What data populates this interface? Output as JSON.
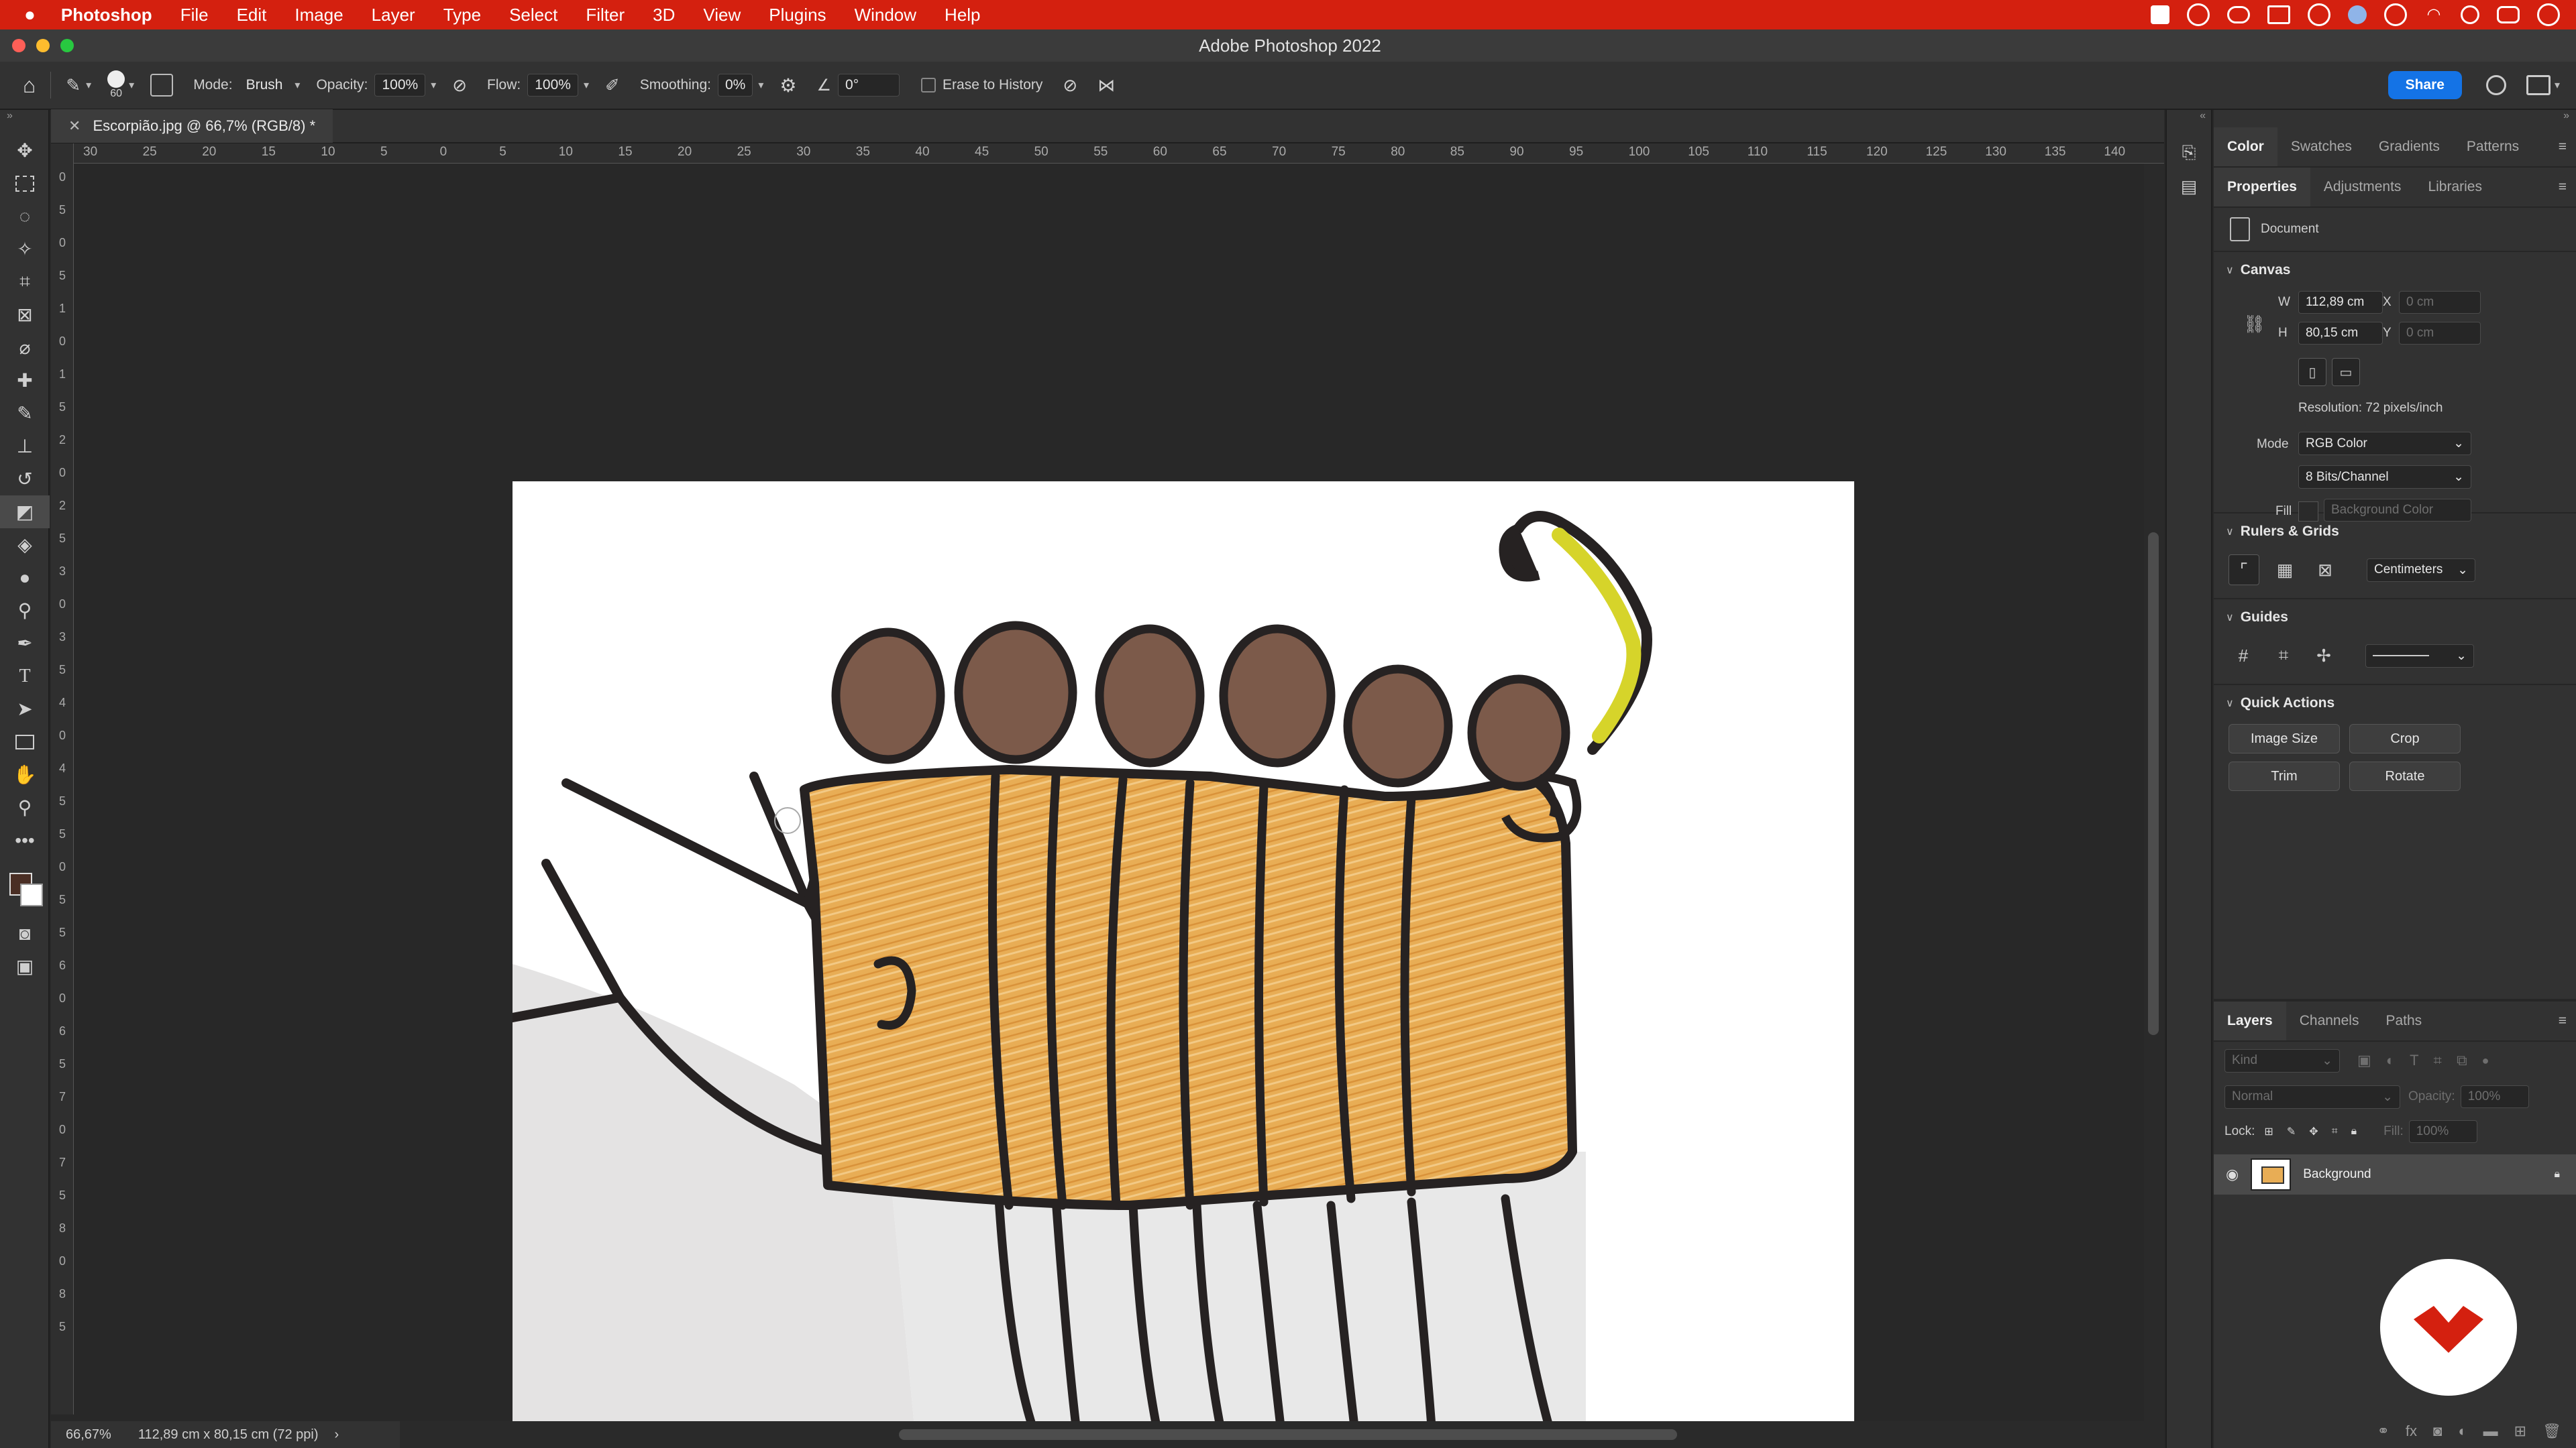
{
  "menubar": {
    "app": "Photoshop",
    "items": [
      "File",
      "Edit",
      "Image",
      "Layer",
      "Type",
      "Select",
      "Filter",
      "3D",
      "View",
      "Plugins",
      "Window",
      "Help"
    ]
  },
  "window": {
    "title": "Adobe Photoshop 2022"
  },
  "options": {
    "brush_size": "60",
    "mode_label": "Mode:",
    "mode_value": "Brush",
    "opacity_label": "Opacity:",
    "opacity_value": "100%",
    "flow_label": "Flow:",
    "flow_value": "100%",
    "smoothing_label": "Smoothing:",
    "smoothing_value": "0%",
    "angle_value": "0°",
    "erase_history_label": "Erase to History",
    "share_label": "Share"
  },
  "document": {
    "tab_title": "Escorpião.jpg @ 66,7% (RGB/8) *",
    "zoom": "66,67%",
    "size_info": "112,89 cm x 80,15 cm (72 ppi)"
  },
  "rulers": {
    "h_ticks": [
      "30",
      "25",
      "20",
      "15",
      "10",
      "5",
      "0",
      "5",
      "10",
      "15",
      "20",
      "25",
      "30",
      "35",
      "40",
      "45",
      "50",
      "55",
      "60",
      "65",
      "70",
      "75",
      "80",
      "85",
      "90",
      "95",
      "100",
      "105",
      "110",
      "115",
      "120",
      "125",
      "130",
      "135",
      "140"
    ],
    "v_ticks": [
      "0",
      "5",
      "0",
      "5",
      "1",
      "0",
      "1",
      "5",
      "2",
      "0",
      "2",
      "5",
      "3",
      "0",
      "3",
      "5",
      "4",
      "0",
      "4",
      "5",
      "5",
      "0",
      "5",
      "5",
      "6",
      "0",
      "6",
      "5",
      "7",
      "0",
      "7",
      "5",
      "8",
      "0",
      "8",
      "5"
    ]
  },
  "panels": {
    "top_tabs": [
      "Color",
      "Swatches",
      "Gradients",
      "Patterns"
    ],
    "prop_tabs": [
      "Properties",
      "Adjustments",
      "Libraries"
    ],
    "properties": {
      "doc_label": "Document",
      "canvas_header": "Canvas",
      "w_label": "W",
      "w_value": "112,89 cm",
      "h_label": "H",
      "h_value": "80,15 cm",
      "x_label": "X",
      "x_placeholder": "0 cm",
      "y_label": "Y",
      "y_placeholder": "0 cm",
      "resolution": "Resolution: 72 pixels/inch",
      "mode_label": "Mode",
      "mode_value": "RGB Color",
      "bits_value": "8 Bits/Channel",
      "fill_label": "Fill",
      "fill_value": "Background Color",
      "rulers_header": "Rulers & Grids",
      "units_value": "Centimeters",
      "guides_header": "Guides",
      "quick_header": "Quick Actions",
      "quick_buttons": [
        "Image Size",
        "Crop",
        "Trim",
        "Rotate"
      ]
    },
    "layer_tabs": [
      "Layers",
      "Channels",
      "Paths"
    ],
    "layers": {
      "kind_placeholder": "Kind",
      "blend_value": "Normal",
      "opacity_label": "Opacity:",
      "opacity_value": "100%",
      "lock_label": "Lock:",
      "fill_label": "Fill:",
      "fill_value": "100%",
      "items": [
        {
          "name": "Background"
        }
      ]
    }
  },
  "colors": {
    "menubar": "#d4200f",
    "accent": "#1473e6",
    "panel": "#323232",
    "canvas_bg": "#282828"
  }
}
